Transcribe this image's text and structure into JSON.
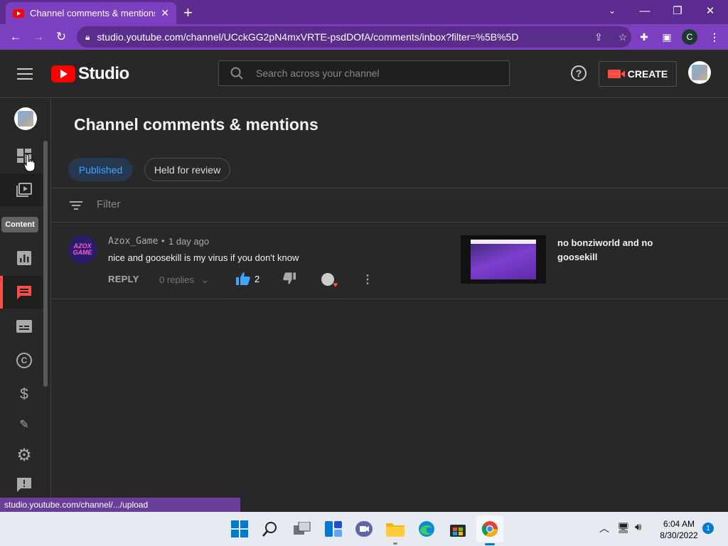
{
  "browser": {
    "tab_title": "Channel comments & mentions -",
    "url": "studio.youtube.com/channel/UCckGG2pN4mxVRTE-psdDOfA/comments/inbox?filter=%5B%5D",
    "profile_letter": "C"
  },
  "studio": {
    "logo_text": "Studio",
    "search_placeholder": "Search across your channel",
    "create_label": "CREATE"
  },
  "sidebar": {
    "tooltip": "Content",
    "items": [
      {
        "name": "dashboard",
        "icon": "dashboard-icon"
      },
      {
        "name": "content",
        "icon": "video-content-icon"
      },
      {
        "name": "analytics",
        "icon": "analytics-icon"
      },
      {
        "name": "comments",
        "icon": "comments-icon",
        "active": true
      },
      {
        "name": "subtitles",
        "icon": "subtitles-icon"
      },
      {
        "name": "copyright",
        "icon": "copyright-icon",
        "glyph": "©"
      },
      {
        "name": "monetization",
        "icon": "dollar-icon",
        "glyph": "$"
      },
      {
        "name": "customization",
        "icon": "magic-wand-icon"
      },
      {
        "name": "settings",
        "icon": "gear-icon"
      },
      {
        "name": "feedback",
        "icon": "feedback-icon"
      }
    ]
  },
  "main": {
    "page_title": "Channel comments & mentions",
    "tabs": [
      {
        "label": "Published",
        "active": true
      },
      {
        "label": "Held for review",
        "active": false
      }
    ],
    "filter_placeholder": "Filter",
    "comments": [
      {
        "avatar_text": "AZOX GAME",
        "author": "Azox_Game",
        "time": "1 day ago",
        "text": "nice and goosekill is my virus if you don't know",
        "reply_label": "REPLY",
        "replies_label": "0 replies",
        "like_count": "2",
        "video_title": "no bonziworld and no goosekill"
      }
    ]
  },
  "status_bar": {
    "url": "studio.youtube.com/channel/.../upload"
  },
  "taskbar": {
    "time": "6:04 AM",
    "date": "8/30/2022",
    "notification_count": "1"
  },
  "colors": {
    "accent_purple": "#7b3fbf",
    "studio_bg": "#282828",
    "brand_red": "#ff0000",
    "link_blue": "#3ea6ff"
  }
}
